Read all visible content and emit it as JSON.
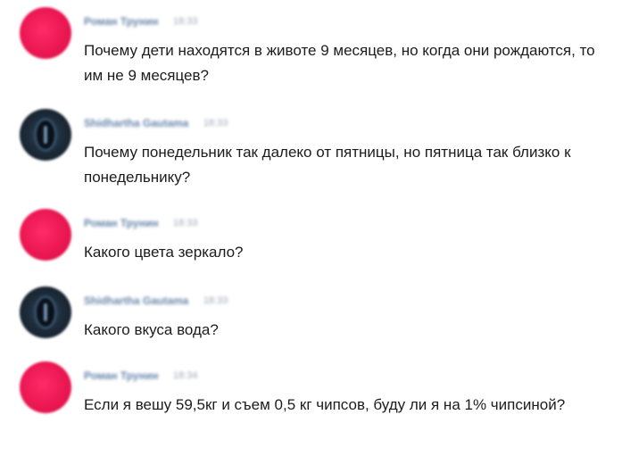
{
  "messages": [
    {
      "author": "Роман Трунин",
      "time": "18:33",
      "avatar": "pink-avatar",
      "text": "Почему дети находятся в животе 9 месяцев, но когда они рождаются, то им не 9 месяцев?"
    },
    {
      "author": "Shidhartha Gautama",
      "time": "18:33",
      "avatar": "dark-avatar",
      "text": "Почему понедельник так далеко от пятницы, но пятница так близко к понедельнику?"
    },
    {
      "author": "Роман Трунин",
      "time": "18:33",
      "avatar": "pink-avatar",
      "text": "Какого цвета зеркало?"
    },
    {
      "author": "Shidhartha Gautama",
      "time": "18:33",
      "avatar": "dark-avatar",
      "text": "Какого вкуса вода?"
    },
    {
      "author": "Роман Трунин",
      "time": "18:34",
      "avatar": "pink-avatar",
      "text": "Если я вешу 59,5кг и съем 0,5 кг чипсов, буду ли я на 1% чипсиной?"
    }
  ],
  "colors": {
    "author": "#4a6f9a",
    "time": "#9aa6b3",
    "text": "#1c1c1c",
    "avatar_pink": "#ea1752",
    "avatar_dark": "#1e2d3c"
  }
}
